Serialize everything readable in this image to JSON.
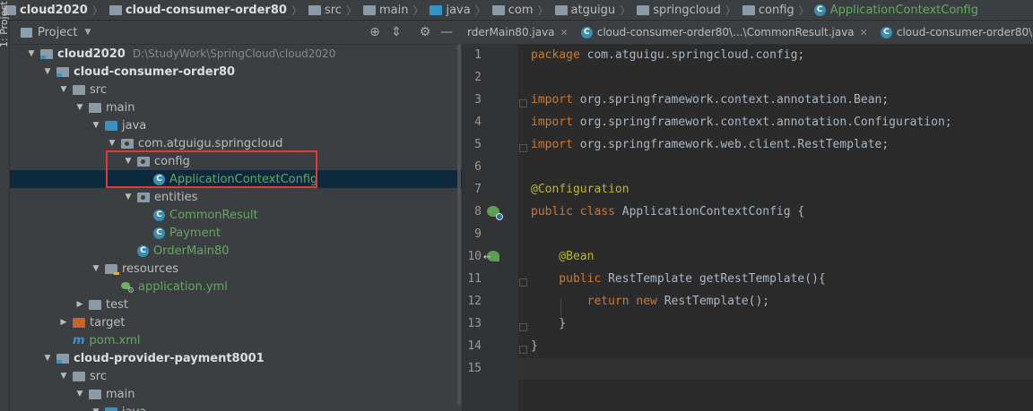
{
  "breadcrumb": [
    {
      "label": "cloud2020",
      "bold": true,
      "icon": "module-folder-icon"
    },
    {
      "label": "cloud-consumer-order80",
      "bold": true,
      "icon": "module-folder-icon"
    },
    {
      "label": "src",
      "bold": false,
      "icon": "folder-icon"
    },
    {
      "label": "main",
      "bold": false,
      "icon": "folder-icon"
    },
    {
      "label": "java",
      "bold": false,
      "icon": "source-folder-icon"
    },
    {
      "label": "com",
      "bold": false,
      "icon": "package-icon"
    },
    {
      "label": "atguigu",
      "bold": false,
      "icon": "package-icon"
    },
    {
      "label": "springcloud",
      "bold": false,
      "icon": "package-icon"
    },
    {
      "label": "config",
      "bold": false,
      "icon": "package-icon"
    },
    {
      "label": "ApplicationContextConfig",
      "bold": false,
      "icon": "class-icon"
    }
  ],
  "side_strip_label": "1: Project",
  "panel": {
    "title": "Project",
    "icons": [
      "crosshair-icon",
      "collapse-icon",
      "gear-icon",
      "hide-icon"
    ]
  },
  "tree": [
    {
      "depth": 0,
      "arrow": "down",
      "icon": "module",
      "label": "cloud2020",
      "bold": true,
      "path": "D:\\StudyWork\\SpringCloud\\cloud2020"
    },
    {
      "depth": 1,
      "arrow": "down",
      "icon": "module",
      "label": "cloud-consumer-order80",
      "bold": true
    },
    {
      "depth": 2,
      "arrow": "down",
      "icon": "grey",
      "label": "src"
    },
    {
      "depth": 3,
      "arrow": "down",
      "icon": "grey",
      "label": "main"
    },
    {
      "depth": 4,
      "arrow": "down",
      "icon": "blue",
      "label": "java"
    },
    {
      "depth": 5,
      "arrow": "down",
      "icon": "pkg",
      "label": "com.atguigu.springcloud"
    },
    {
      "depth": 6,
      "arrow": "down",
      "icon": "pkg",
      "label": "config"
    },
    {
      "depth": 7,
      "arrow": "none",
      "icon": "class",
      "label": "ApplicationContextConfig",
      "green": true,
      "selected": true
    },
    {
      "depth": 6,
      "arrow": "down",
      "icon": "pkg",
      "label": "entities"
    },
    {
      "depth": 7,
      "arrow": "none",
      "icon": "class",
      "label": "CommonResult",
      "green": true
    },
    {
      "depth": 7,
      "arrow": "none",
      "icon": "class",
      "label": "Payment",
      "green": true
    },
    {
      "depth": 6,
      "arrow": "none",
      "icon": "spring-class",
      "label": "OrderMain80",
      "green": true
    },
    {
      "depth": 4,
      "arrow": "down",
      "icon": "res",
      "label": "resources"
    },
    {
      "depth": 5,
      "arrow": "none",
      "icon": "yml",
      "label": "application.yml",
      "green": true
    },
    {
      "depth": 3,
      "arrow": "right",
      "icon": "grey",
      "label": "test"
    },
    {
      "depth": 2,
      "arrow": "right",
      "icon": "orange",
      "label": "target"
    },
    {
      "depth": 2,
      "arrow": "none",
      "icon": "maven",
      "label": "pom.xml",
      "green": true
    },
    {
      "depth": 1,
      "arrow": "down",
      "icon": "module",
      "label": "cloud-provider-payment8001",
      "bold": true
    },
    {
      "depth": 2,
      "arrow": "down",
      "icon": "grey",
      "label": "src"
    },
    {
      "depth": 3,
      "arrow": "down",
      "icon": "grey",
      "label": "main"
    },
    {
      "depth": 4,
      "arrow": "down",
      "icon": "blue",
      "label": "java"
    }
  ],
  "tabs": [
    {
      "label": "rderMain80.java",
      "icon": "none"
    },
    {
      "label": "cloud-consumer-order80\\...\\CommonResult.java",
      "icon": "class-icon"
    },
    {
      "label": "cloud-consumer-order80\\...\\",
      "icon": "class-icon"
    }
  ],
  "code_lines": [
    [
      {
        "t": "package ",
        "c": "kw"
      },
      {
        "t": "com.atguigu.springcloud.config;",
        "c": "cls"
      }
    ],
    [],
    [
      {
        "t": "import ",
        "c": "kw"
      },
      {
        "t": "org.springframework.context.annotation.Bean;",
        "c": "cls"
      }
    ],
    [
      {
        "t": "import ",
        "c": "kw"
      },
      {
        "t": "org.springframework.context.annotation.Configuration;",
        "c": "cls"
      }
    ],
    [
      {
        "t": "import ",
        "c": "kw"
      },
      {
        "t": "org.springframework.web.client.RestTemplate;",
        "c": "cls"
      }
    ],
    [],
    [
      {
        "t": "@Configuration",
        "c": "ann"
      }
    ],
    [
      {
        "t": "public class ",
        "c": "kw"
      },
      {
        "t": "ApplicationContextConfig {",
        "c": "cls"
      }
    ],
    [],
    [
      {
        "t": "    @Bean",
        "c": "ann"
      }
    ],
    [
      {
        "t": "    public ",
        "c": "kw"
      },
      {
        "t": "RestTemplate getRestTemplate(){",
        "c": "cls"
      }
    ],
    [
      {
        "t": "        return new ",
        "c": "kw"
      },
      {
        "t": "RestTemplate();",
        "c": "cls"
      }
    ],
    [
      {
        "t": "    }",
        "c": "cls"
      }
    ],
    [
      {
        "t": "}",
        "c": "cls"
      }
    ],
    []
  ],
  "line_numbers": [
    "1",
    "2",
    "3",
    "4",
    "5",
    "6",
    "7",
    "8",
    "9",
    "10",
    "11",
    "12",
    "13",
    "14",
    "15"
  ],
  "colors": {
    "highlight": "#e53935",
    "selection": "#0d293e",
    "keyword": "#cc7832",
    "annotation": "#bbb529"
  }
}
